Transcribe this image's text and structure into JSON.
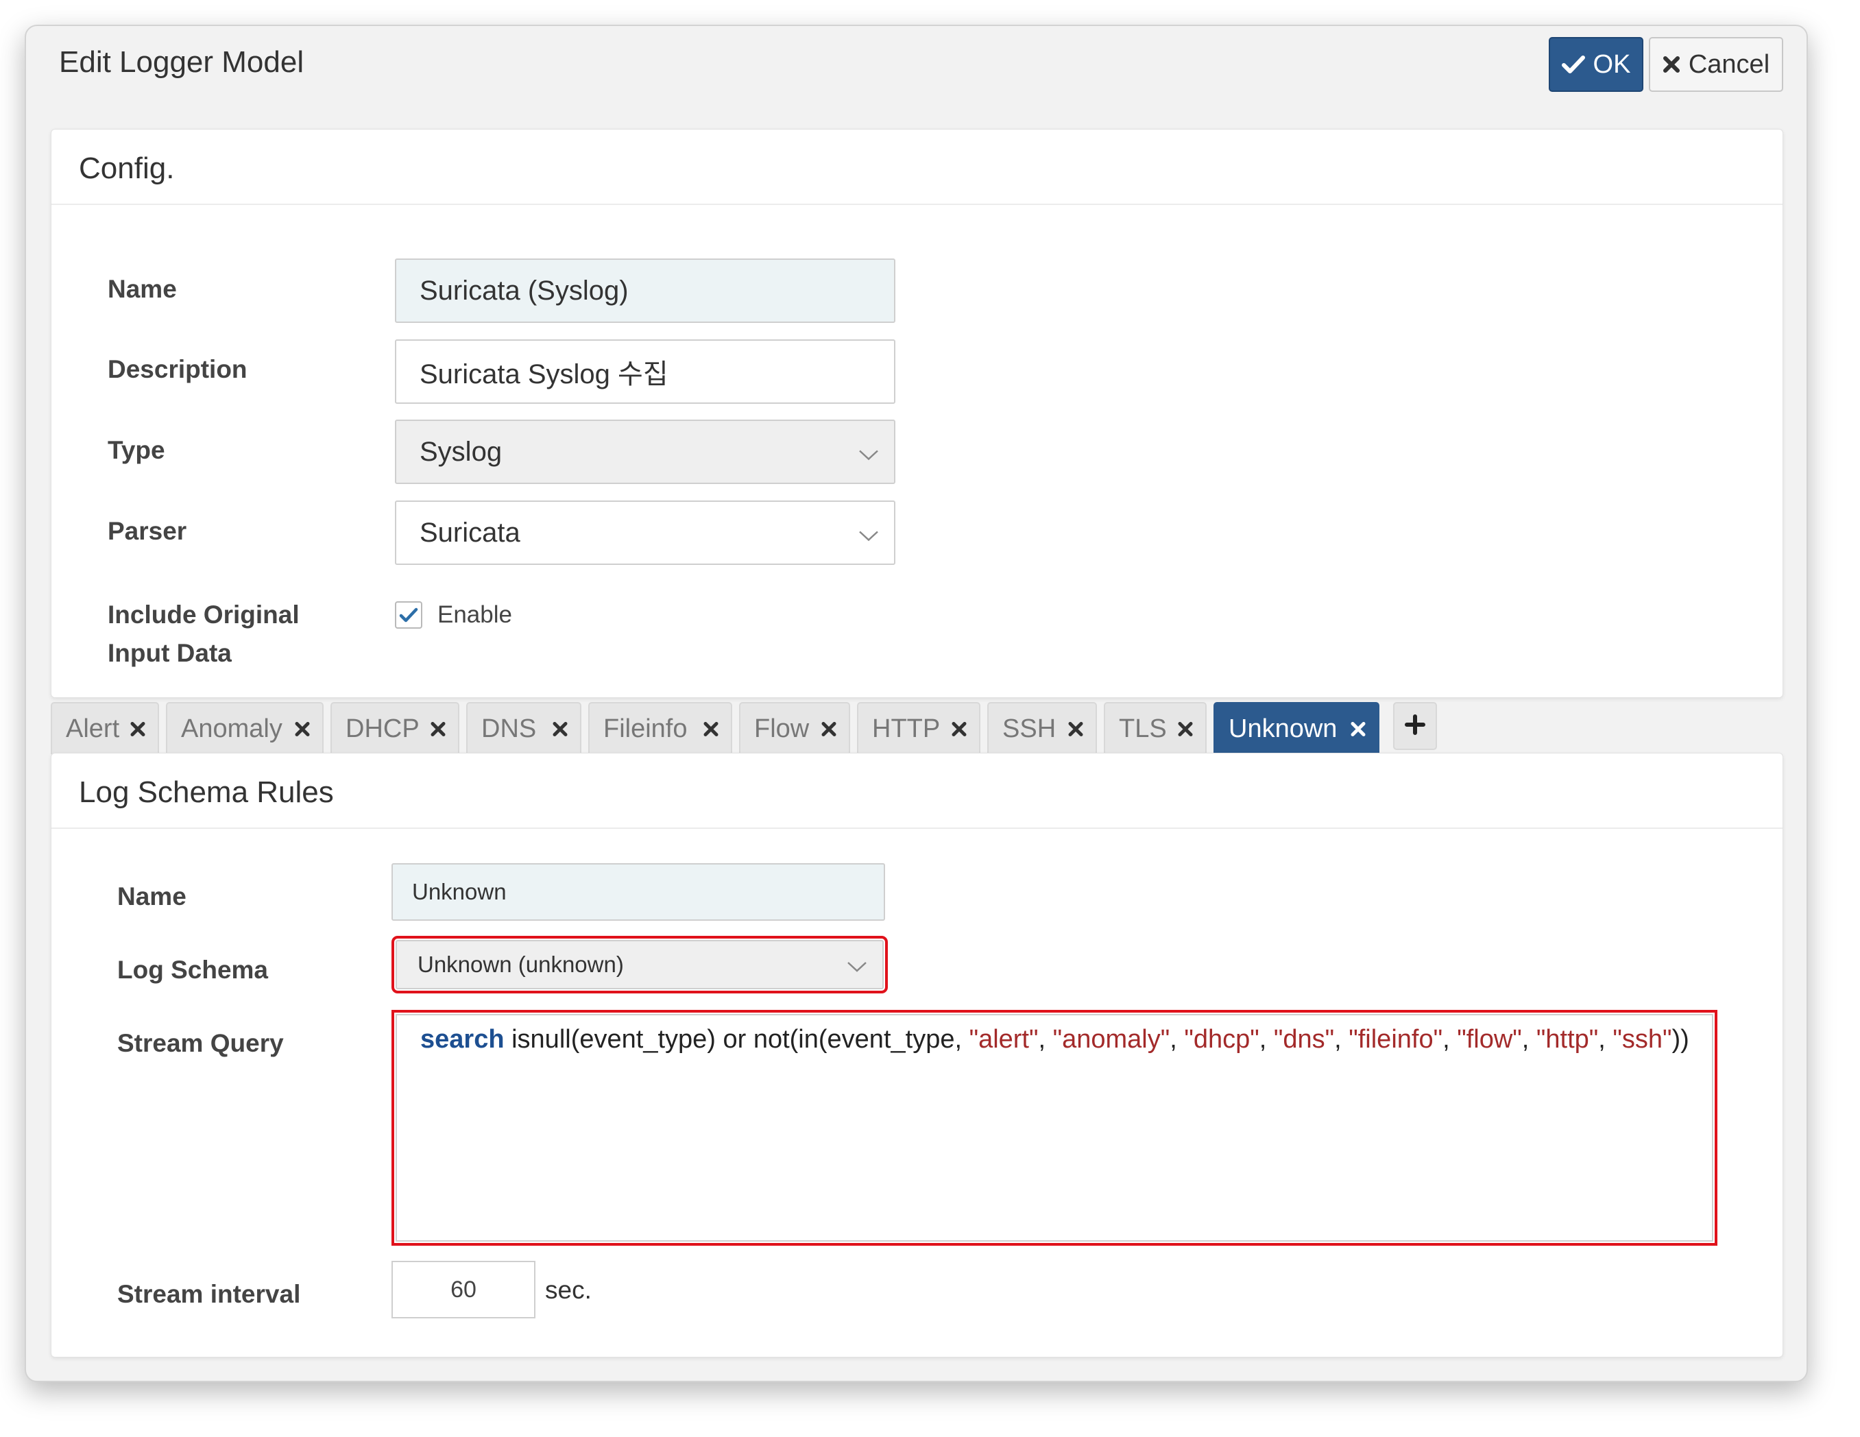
{
  "dialog": {
    "title": "Edit Logger Model",
    "ok_label": "OK",
    "cancel_label": "Cancel"
  },
  "config": {
    "title": "Config.",
    "name_label": "Name",
    "name_value": "Suricata (Syslog)",
    "description_label": "Description",
    "description_value": "Suricata Syslog 수집",
    "type_label": "Type",
    "type_value": "Syslog",
    "parser_label": "Parser",
    "parser_value": "Suricata",
    "include_label_line1": "Include Original",
    "include_label_line2": "Input Data",
    "include_checked": true,
    "include_option": "Enable"
  },
  "tabs": [
    {
      "label": "Alert",
      "active": false
    },
    {
      "label": "Anomaly",
      "active": false
    },
    {
      "label": "DHCP",
      "active": false
    },
    {
      "label": "DNS",
      "active": false
    },
    {
      "label": "Fileinfo",
      "active": false
    },
    {
      "label": "Flow",
      "active": false
    },
    {
      "label": "HTTP",
      "active": false
    },
    {
      "label": "SSH",
      "active": false
    },
    {
      "label": "TLS",
      "active": false
    },
    {
      "label": "Unknown",
      "active": true
    }
  ],
  "rules": {
    "title": "Log Schema Rules",
    "name_label": "Name",
    "name_value": "Unknown",
    "schema_label": "Log Schema",
    "schema_value": "Unknown (unknown)",
    "query_label": "Stream Query",
    "query_keyword": "search",
    "query_part1": " isnull(event_type) or not(in(event_type, ",
    "query_strings": [
      "\"alert\"",
      "\"anomaly\"",
      "\"dhcp\"",
      "\"dns\"",
      "\"fileinfo\"",
      "\"flow\"",
      "\"http\"",
      "\"ssh\""
    ],
    "query_separator": ", ",
    "query_end": "))",
    "interval_label": "Stream interval",
    "interval_value": "60",
    "interval_unit": "sec."
  },
  "colors": {
    "accent": "#2c5a8e",
    "highlight_border": "#e0121b",
    "query_keyword": "#1d4f91",
    "query_string": "#a32a2a"
  }
}
